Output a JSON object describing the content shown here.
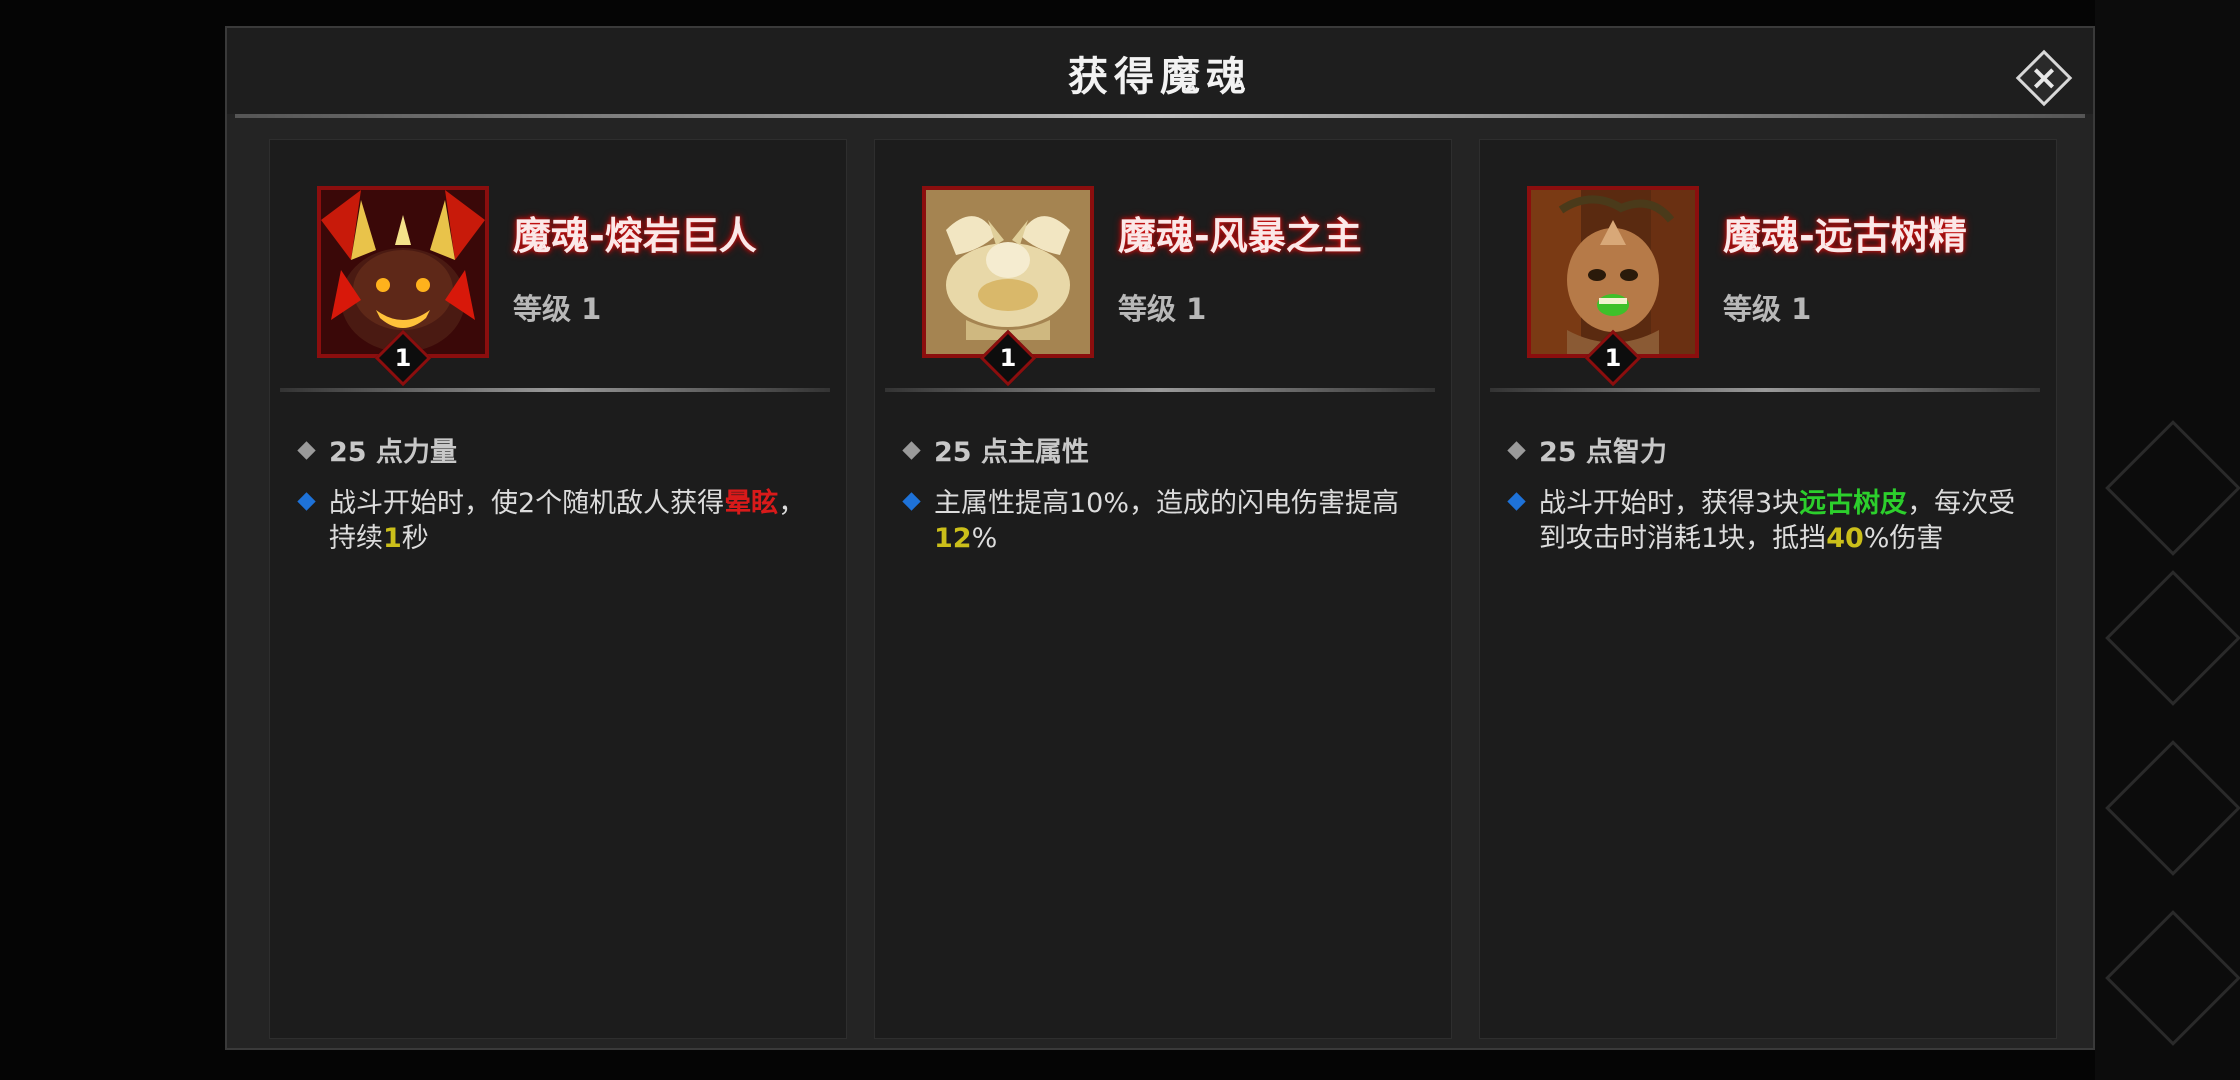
{
  "dialog": {
    "title": "获得魔魂",
    "close_label": "×"
  },
  "cards": [
    {
      "name": "魔魂-熔岩巨人",
      "level_text": "等级 1",
      "badge": "1",
      "stat": "25 点力量",
      "desc": [
        {
          "t": "战斗开始时，使2个随机敌人获得",
          "c": ""
        },
        {
          "t": "晕眩",
          "c": "red"
        },
        {
          "t": "，持续",
          "c": ""
        },
        {
          "t": "1",
          "c": "yellow"
        },
        {
          "t": "秒",
          "c": ""
        }
      ],
      "portrait": "lava-giant-icon"
    },
    {
      "name": "魔魂-风暴之主",
      "level_text": "等级 1",
      "badge": "1",
      "stat": "25 点主属性",
      "desc": [
        {
          "t": "主属性提高10%，造成的闪电伤害提高",
          "c": ""
        },
        {
          "t": "12",
          "c": "yellow"
        },
        {
          "t": "%",
          "c": ""
        }
      ],
      "portrait": "storm-lord-icon"
    },
    {
      "name": "魔魂-远古树精",
      "level_text": "等级 1",
      "badge": "1",
      "stat": "25 点智力",
      "desc": [
        {
          "t": "战斗开始时，获得3块",
          "c": ""
        },
        {
          "t": "远古树皮",
          "c": "green"
        },
        {
          "t": "，每次受到攻击时消耗1块，抵挡",
          "c": ""
        },
        {
          "t": "40",
          "c": "yellow"
        },
        {
          "t": "%伤害",
          "c": ""
        }
      ],
      "portrait": "ancient-treant-icon"
    }
  ],
  "colors": {
    "frame_red": "#8b0e0e",
    "highlight_red": "#d81a1a",
    "highlight_yellow": "#cbbf1a",
    "highlight_green": "#2ccf2c",
    "bullet_blue": "#1e72d8"
  }
}
